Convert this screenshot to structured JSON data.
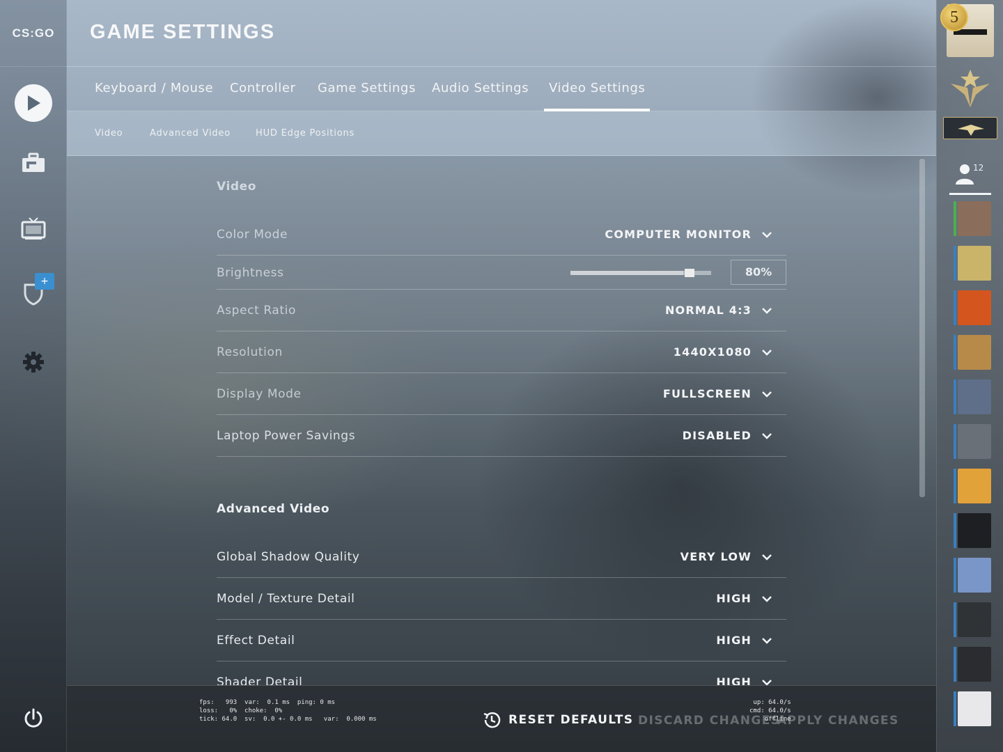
{
  "app": {
    "logo": "CS:GO",
    "title": "GAME SETTINGS"
  },
  "tabs": [
    {
      "label": "Keyboard / Mouse"
    },
    {
      "label": "Controller"
    },
    {
      "label": "Game Settings"
    },
    {
      "label": "Audio Settings"
    },
    {
      "label": "Video Settings",
      "active": true
    }
  ],
  "subtabs": [
    {
      "label": "Video"
    },
    {
      "label": "Advanced Video"
    },
    {
      "label": "HUD Edge Positions"
    }
  ],
  "video": {
    "heading": "Video",
    "color_mode": {
      "label": "Color Mode",
      "value": "COMPUTER MONITOR"
    },
    "brightness": {
      "label": "Brightness",
      "value_text": "80%",
      "level": 0.8
    },
    "aspect_ratio": {
      "label": "Aspect Ratio",
      "value": "NORMAL 4:3"
    },
    "resolution": {
      "label": "Resolution",
      "value": "1440X1080"
    },
    "display_mode": {
      "label": "Display Mode",
      "value": "FULLSCREEN"
    },
    "laptop_power": {
      "label": "Laptop Power Savings",
      "value": "DISABLED"
    }
  },
  "advanced": {
    "heading": "Advanced Video",
    "shadow": {
      "label": "Global Shadow Quality",
      "value": "VERY LOW"
    },
    "model_texture": {
      "label": "Model / Texture Detail",
      "value": "HIGH"
    },
    "effect": {
      "label": "Effect Detail",
      "value": "HIGH"
    },
    "shader": {
      "label": "Shader Detail",
      "value": "HIGH"
    }
  },
  "netgraph": {
    "left": "fps:   993  var:  0.1 ms  ping: 0 ms\nloss:   0%  choke:  0%\ntick: 64.0  sv:  0.0 +- 0.0 ms   var:  0.000 ms",
    "right": "up: 64.0/s\ncmd: 64.0/s\noffline"
  },
  "footer": {
    "reset": "RESET DEFAULTS",
    "discard": "DISCARD CHANGES",
    "apply": "APPLY CHANGES"
  },
  "social": {
    "level": "5",
    "friends_online": "12",
    "friend_colors": [
      "#8a6d5a",
      "#c9b46a",
      "#d4561e",
      "#b88a4a",
      "#5f6f8a",
      "#6a7078",
      "#e2a23a",
      "#1d1f22",
      "#7a95c8",
      "#303336",
      "#2a2c30",
      "#e8e8ea"
    ]
  },
  "icons": {
    "play": "play-icon",
    "inventory": "briefcase-icon",
    "watch": "tv-icon",
    "operation": "shield-icon",
    "settings": "gear-icon",
    "power": "power-icon",
    "reset": "history-icon",
    "friends": "person-icon"
  }
}
